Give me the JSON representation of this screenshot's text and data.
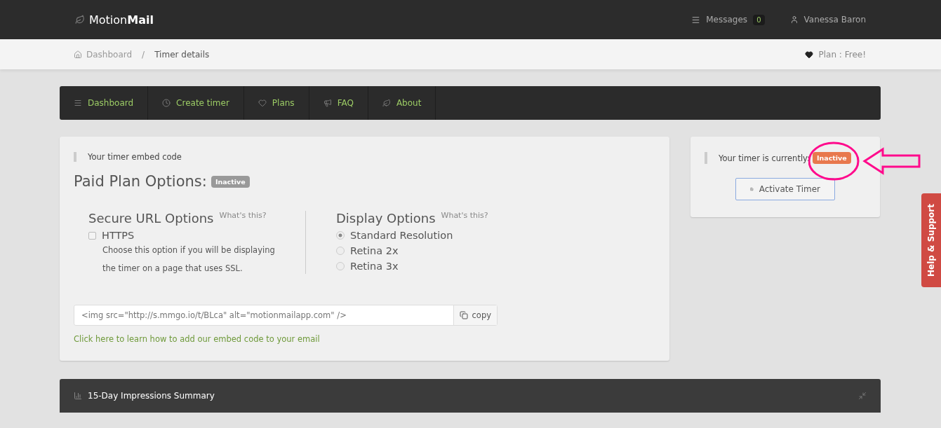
{
  "header": {
    "brand": "Motion**Mail**",
    "messages": {
      "label": "Messages",
      "count": "0"
    },
    "user": "Vanessa Baron"
  },
  "breadcrumb": {
    "items": [
      {
        "label": "Dashboard"
      },
      {
        "label": "Timer details"
      }
    ],
    "separator": "/",
    "plan": "Plan : Free!"
  },
  "nav": {
    "items": [
      {
        "label": "Dashboard"
      },
      {
        "label": "Create timer"
      },
      {
        "label": "Plans"
      },
      {
        "label": "FAQ"
      },
      {
        "label": "About"
      }
    ]
  },
  "embed_card": {
    "note": "Your timer embed code",
    "title": "Paid Plan Options:",
    "badge": "Inactive",
    "secure": {
      "title": "Secure URL Options",
      "help": "What's this?",
      "option": {
        "label": "HTTPS",
        "checked": false
      },
      "description": "Choose this option if you will be displaying the timer on a page that uses SSL."
    },
    "display": {
      "title": "Display Options",
      "help": "What's this?",
      "options": [
        {
          "label": "Standard Resolution",
          "selected": true
        },
        {
          "label": "Retina 2x",
          "selected": false
        },
        {
          "label": "Retina 3x",
          "selected": false
        }
      ]
    },
    "code": "<img src=\"http://s.mmgo.io/t/BLca\" alt=\"motionmailapp.com\" />",
    "copy": "copy",
    "link": "Click here to learn how to add our embed code to your email"
  },
  "status_card": {
    "text": "Your timer is currently:",
    "badge": "Inactive",
    "button": "Activate Timer"
  },
  "summary": {
    "title": "15-Day Impressions Summary"
  },
  "help_tab": "Help & Support"
}
